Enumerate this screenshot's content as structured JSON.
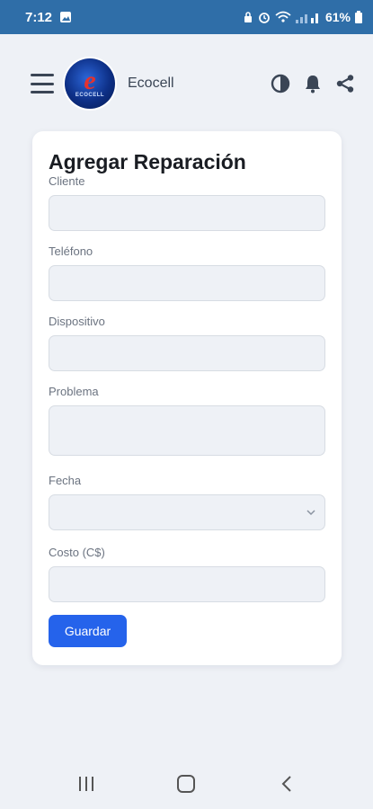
{
  "status_bar": {
    "time": "7:12",
    "battery": "61%"
  },
  "header": {
    "brand_name": "Ecocell",
    "logo_mark": "e",
    "logo_text": "ECOCELL",
    "icons": [
      "menu-icon",
      "contrast-icon",
      "bell-icon",
      "share-icon"
    ]
  },
  "form": {
    "title": "Agregar Reparación",
    "fields": [
      {
        "label": "Cliente",
        "value": "",
        "placeholder": ""
      },
      {
        "label": "Teléfono",
        "value": "",
        "placeholder": ""
      },
      {
        "label": "Dispositivo",
        "value": "",
        "placeholder": ""
      },
      {
        "label": "Problema",
        "value": "",
        "placeholder": ""
      },
      {
        "label": "Fecha",
        "value": "",
        "placeholder": ""
      },
      {
        "label": "Costo (C$)",
        "value": "",
        "placeholder": ""
      }
    ],
    "save_label": "Guardar"
  },
  "colors": {
    "status_bar": "#2f6ea8",
    "primary_button": "#2563eb",
    "background": "#eef1f6"
  }
}
